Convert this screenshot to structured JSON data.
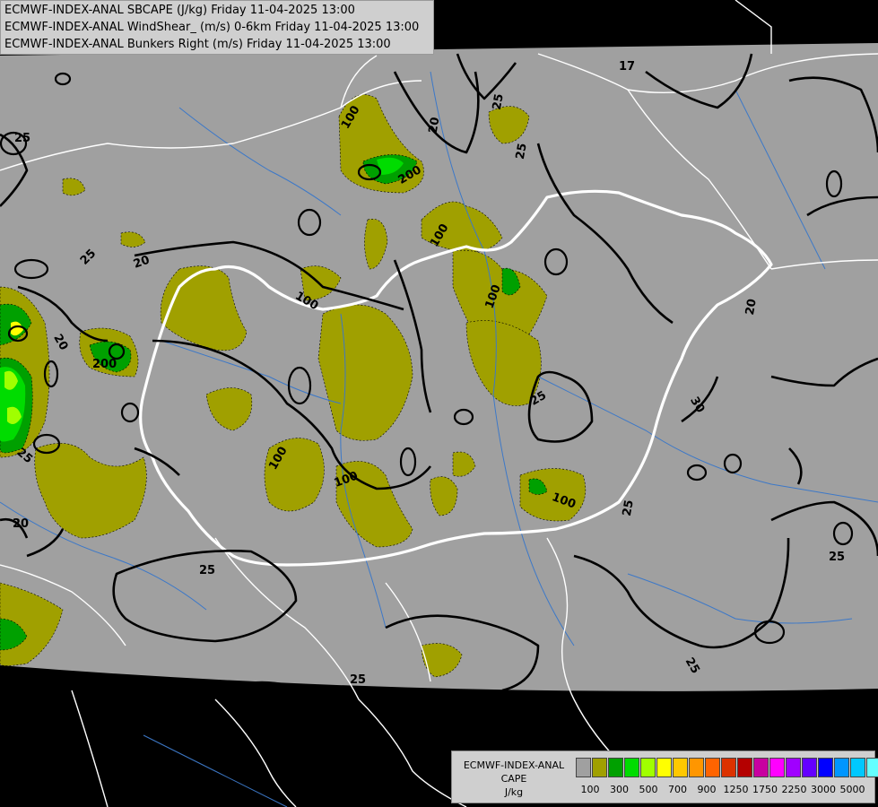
{
  "header": {
    "line1": "ECMWF-INDEX-ANAL SBCAPE (J/kg) Friday 11-04-2025 13:00",
    "line2": "ECMWF-INDEX-ANAL WindShear_ (m/s) 0-6km Friday 11-04-2025 13:00",
    "line3": "ECMWF-INDEX-ANAL Bunkers Right (m/s) Friday 11-04-2025 13:00"
  },
  "legend": {
    "line1": "ECMWF-INDEX-ANAL",
    "line2": "CAPE",
    "line3": "J/kg",
    "colors": [
      "#a0a0a0",
      "#a0a000",
      "#00a000",
      "#00dc00",
      "#a0ff00",
      "#ffff00",
      "#ffc800",
      "#ff9600",
      "#ff6400",
      "#dc3200",
      "#b40000",
      "#c800a0",
      "#ff00ff",
      "#a000ff",
      "#6400ff",
      "#0000ff",
      "#0096ff",
      "#00c8ff",
      "#64ffff",
      "#ffffff"
    ],
    "ticks": [
      "100",
      "300",
      "500",
      "700",
      "900",
      "1250",
      "1750",
      "2250",
      "3000",
      "5000"
    ]
  },
  "contour_labels": [
    "17",
    "25",
    "25",
    "20",
    "25",
    "100",
    "200",
    "100",
    "20",
    "25",
    "100",
    "200",
    "20",
    "100",
    "25",
    "30",
    "20",
    "25",
    "100",
    "100",
    "25",
    "100",
    "25",
    "20",
    "25",
    "25",
    "25"
  ],
  "colors": {
    "outside": "#000000",
    "domain": "#a0a0a0",
    "border": "#ffffff",
    "river": "#3c78c8"
  }
}
